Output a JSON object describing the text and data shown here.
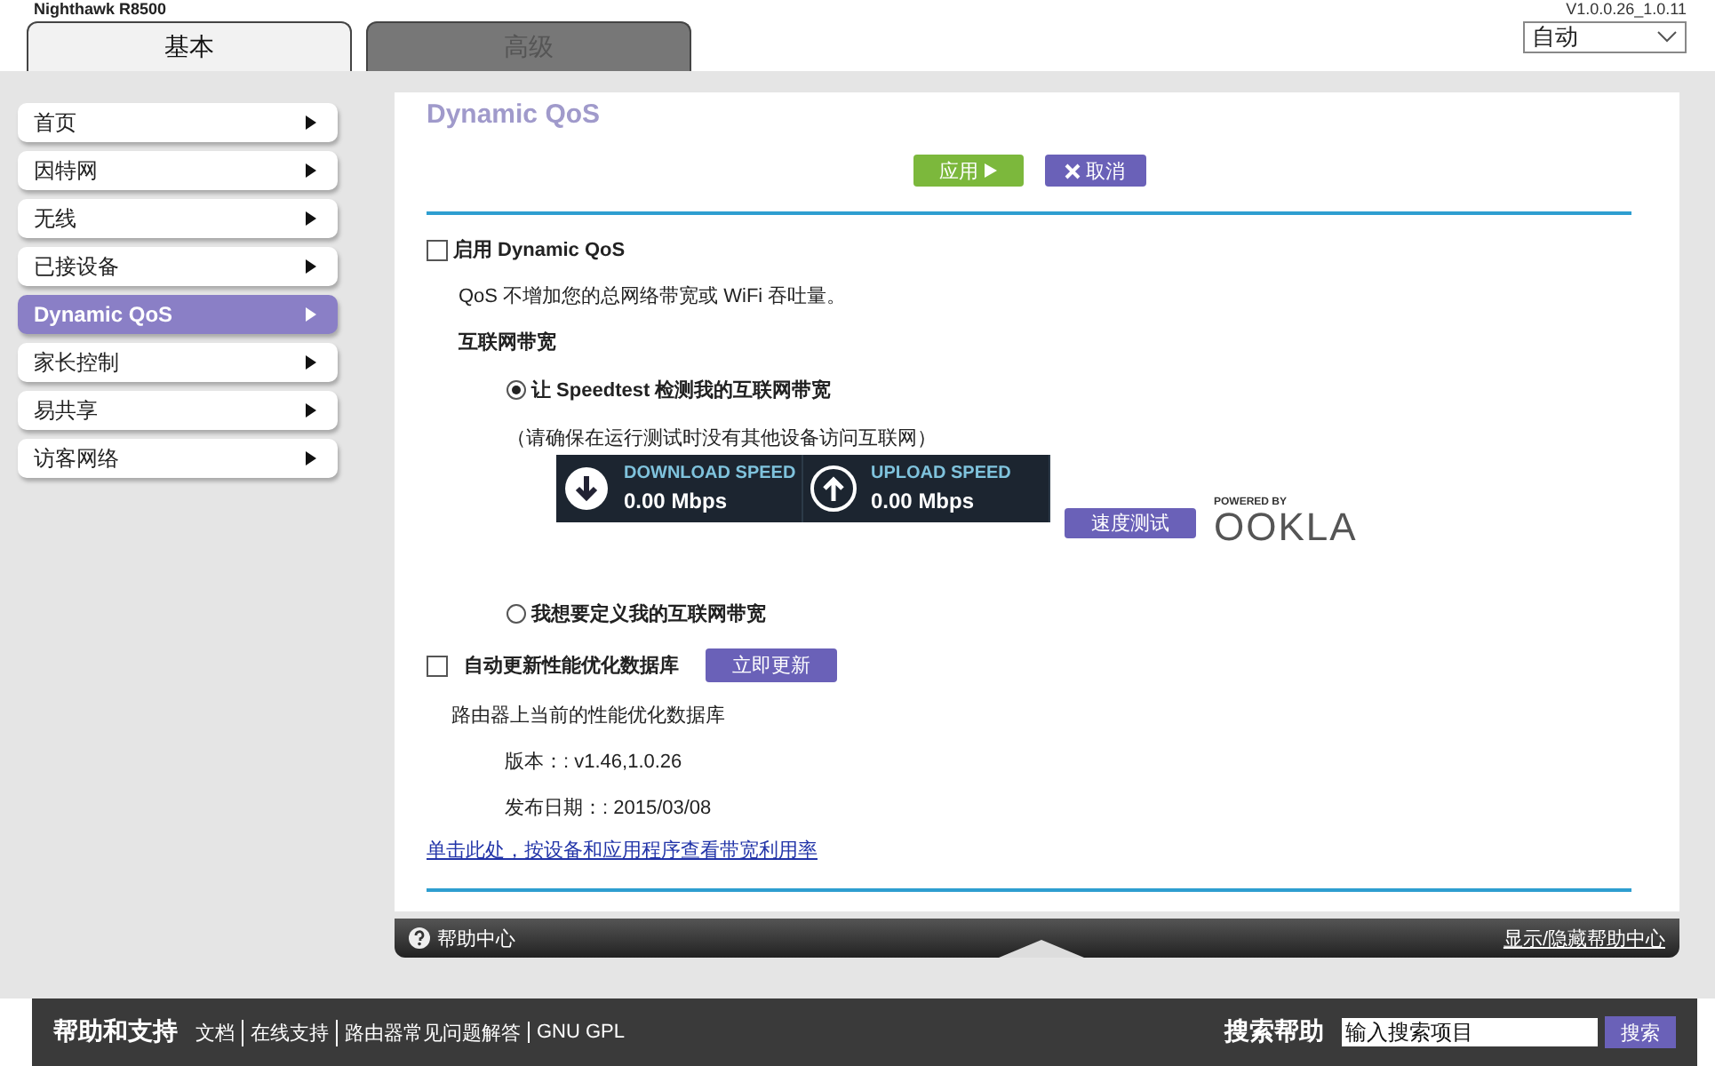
{
  "header": {
    "model": "Nighthawk R8500",
    "firmware": "V1.0.0.26_1.0.11",
    "language": "自动"
  },
  "tabs": [
    {
      "label": "基本",
      "selected": true
    },
    {
      "label": "高级",
      "selected": false
    }
  ],
  "sidebar": {
    "items": [
      {
        "label": "首页",
        "selected": false
      },
      {
        "label": "因特网",
        "selected": false
      },
      {
        "label": "无线",
        "selected": false
      },
      {
        "label": "已接设备",
        "selected": false
      },
      {
        "label": "Dynamic QoS",
        "selected": true
      },
      {
        "label": "家长控制",
        "selected": false
      },
      {
        "label": "易共享",
        "selected": false
      },
      {
        "label": "访客网络",
        "selected": false
      }
    ]
  },
  "page": {
    "title": "Dynamic QoS",
    "apply_button": "应用",
    "cancel_button": "取消",
    "enable": {
      "label": "启用 Dynamic QoS",
      "checked": false
    },
    "note": "QoS 不增加您的总网络带宽或 WiFi 吞吐量。",
    "bandwidth_heading": "互联网带宽",
    "options": [
      {
        "label": "让 Speedtest 检测我的互联网带宽",
        "selected": true,
        "hint": "（请确保在运行测试时没有其他设备访问互联网）"
      },
      {
        "label": "我想要定义我的互联网带宽",
        "selected": false
      }
    ],
    "speedtest": {
      "download_label": "DOWNLOAD SPEED",
      "download_value": "0.00 Mbps",
      "upload_label": "UPLOAD SPEED",
      "upload_value": "0.00 Mbps",
      "button": "速度测试",
      "powered_by": "POWERED BY",
      "brand": "OOKLA"
    },
    "auto_update": {
      "label": "自动更新性能优化数据库",
      "checked": false,
      "button": "立即更新"
    },
    "db_heading": "路由器上当前的性能优化数据库",
    "version": "版本：: v1.46,1.0.26",
    "release_date": "发布日期：: 2015/03/08",
    "link": "单击此处，按设备和应用程序查看带宽利用率"
  },
  "help_bar": {
    "title": "帮助中心",
    "toggle": "显示/隐藏帮助中心"
  },
  "footer": {
    "title": "帮助和支持",
    "links": [
      "文档",
      "在线支持",
      "路由器常见问题解答",
      "GNU GPL"
    ],
    "search_label": "搜索帮助",
    "search_placeholder": "输入搜索项目",
    "search_button": "搜索"
  }
}
